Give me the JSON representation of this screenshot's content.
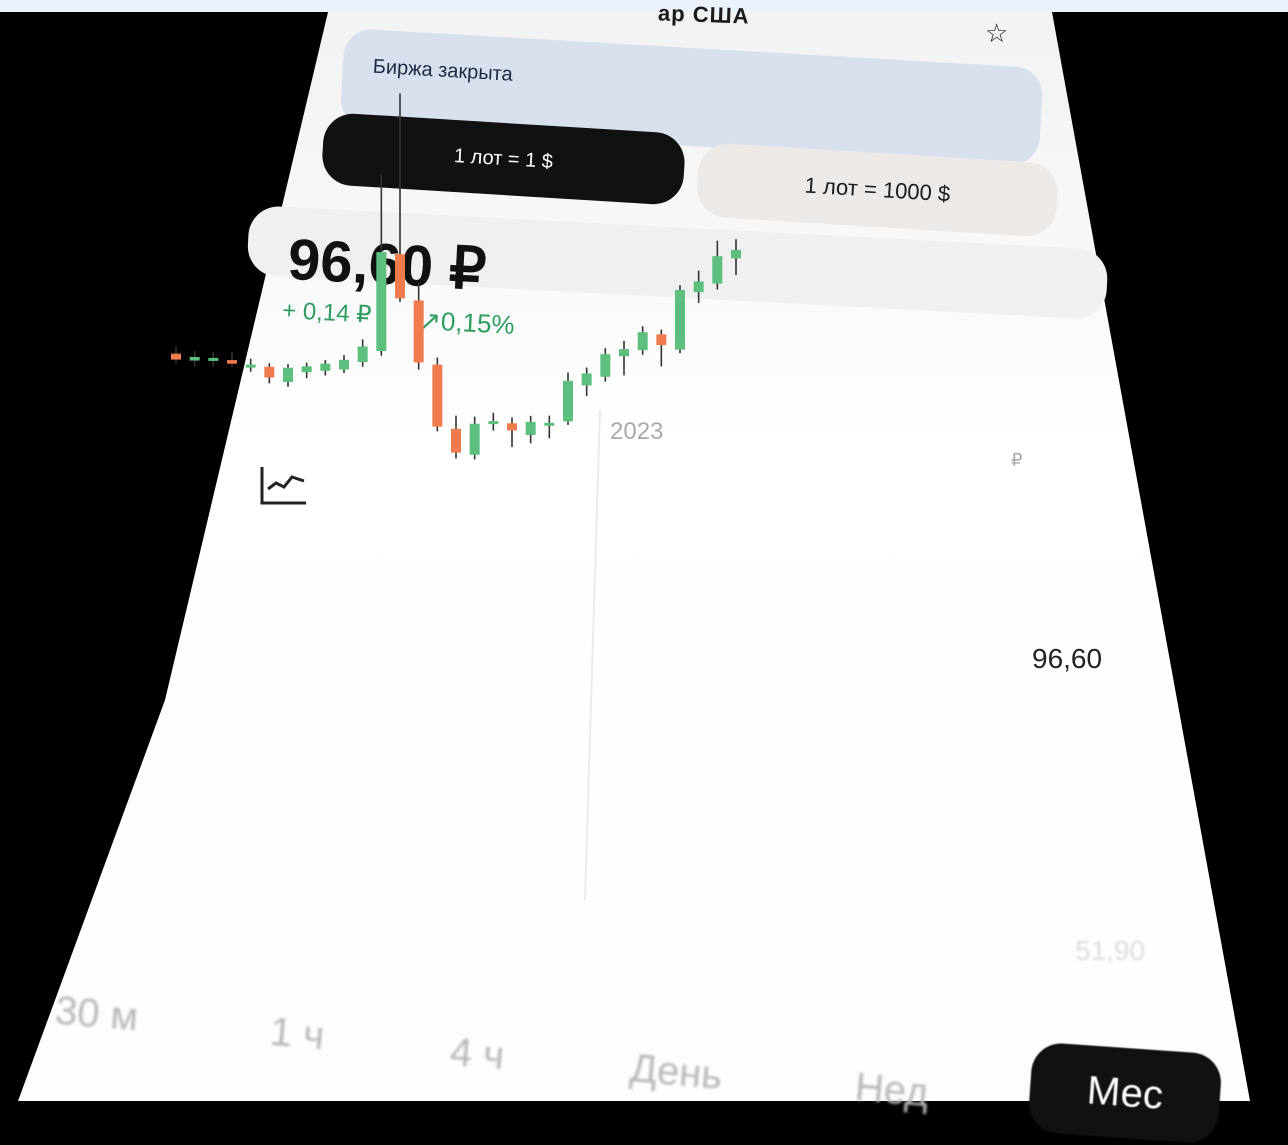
{
  "header": {
    "title_partial": "ар США",
    "favorite_icon": "star-outline-icon",
    "market_status": "Биржа закрыта"
  },
  "lot_options": [
    {
      "label": "1 лот = 1 $",
      "selected": true
    },
    {
      "label": "1 лот = 1000 $",
      "selected": false
    }
  ],
  "quote": {
    "price": "96,60 ₽",
    "change_abs": "+ 0,14 ₽",
    "change_pct": "↗0,15%",
    "change_color": "#2f9d61"
  },
  "chart_toggle_icon": "line-chart-icon",
  "chart_data": {
    "type": "candlestick",
    "year_label": "2023",
    "currency_label": "₽",
    "current_value_label": "96,60",
    "min_value_label": "51,90",
    "up_color": "#5cbf7e",
    "down_color": "#f07c4d",
    "candles": [
      {
        "open": 58.0,
        "high": 58.6,
        "low": 57.2,
        "close": 57.5
      },
      {
        "open": 57.6,
        "high": 58.4,
        "low": 57.1,
        "close": 57.9
      },
      {
        "open": 57.8,
        "high": 58.5,
        "low": 57.3,
        "close": 58.0
      },
      {
        "open": 58.0,
        "high": 58.7,
        "low": 57.4,
        "close": 57.7
      },
      {
        "open": 57.6,
        "high": 58.3,
        "low": 57.2,
        "close": 57.8
      },
      {
        "open": 57.8,
        "high": 58.1,
        "low": 56.4,
        "close": 56.9
      },
      {
        "open": 56.7,
        "high": 58.2,
        "low": 56.3,
        "close": 57.9
      },
      {
        "open": 57.7,
        "high": 58.5,
        "low": 57.2,
        "close": 58.2
      },
      {
        "open": 58.0,
        "high": 58.9,
        "low": 57.6,
        "close": 58.6
      },
      {
        "open": 58.3,
        "high": 59.5,
        "low": 58.0,
        "close": 59.1
      },
      {
        "open": 59.1,
        "high": 61.0,
        "low": 58.7,
        "close": 60.4
      },
      {
        "open": 60.2,
        "high": 75.0,
        "low": 59.8,
        "close": 68.5
      },
      {
        "open": 68.5,
        "high": 82.0,
        "low": 64.5,
        "close": 64.8
      },
      {
        "open": 64.8,
        "high": 66.3,
        "low": 59.0,
        "close": 59.6
      },
      {
        "open": 59.6,
        "high": 60.2,
        "low": 54.0,
        "close": 54.4
      },
      {
        "open": 54.4,
        "high": 55.5,
        "low": 51.9,
        "close": 52.4
      },
      {
        "open": 52.4,
        "high": 55.6,
        "low": 52.0,
        "close": 55.0
      },
      {
        "open": 55.2,
        "high": 56.1,
        "low": 54.6,
        "close": 55.4
      },
      {
        "open": 55.4,
        "high": 55.9,
        "low": 53.4,
        "close": 54.8
      },
      {
        "open": 54.6,
        "high": 56.2,
        "low": 53.9,
        "close": 55.7
      },
      {
        "open": 55.7,
        "high": 56.4,
        "low": 54.5,
        "close": 55.8
      },
      {
        "open": 56.1,
        "high": 60.2,
        "low": 55.8,
        "close": 59.5
      },
      {
        "open": 59.3,
        "high": 60.8,
        "low": 58.4,
        "close": 60.3
      },
      {
        "open": 60.2,
        "high": 62.6,
        "low": 59.8,
        "close": 62.1
      },
      {
        "open": 62.1,
        "high": 63.4,
        "low": 60.5,
        "close": 62.7
      },
      {
        "open": 62.8,
        "high": 64.8,
        "low": 62.4,
        "close": 64.3
      },
      {
        "open": 64.3,
        "high": 64.7,
        "low": 61.6,
        "close": 63.4
      },
      {
        "open": 63.2,
        "high": 68.6,
        "low": 62.9,
        "close": 68.2
      },
      {
        "open": 68.2,
        "high": 70.0,
        "low": 67.3,
        "close": 69.1
      },
      {
        "open": 69.1,
        "high": 72.7,
        "low": 68.6,
        "close": 71.4
      },
      {
        "open": 71.4,
        "high": 73.0,
        "low": 70.0,
        "close": 72.1
      }
    ]
  },
  "timeframes": [
    {
      "label": "30 м"
    },
    {
      "label": "1 ч"
    },
    {
      "label": "4 ч"
    },
    {
      "label": "День"
    },
    {
      "label": "Нед"
    },
    {
      "label": "Мес",
      "selected": true
    }
  ]
}
